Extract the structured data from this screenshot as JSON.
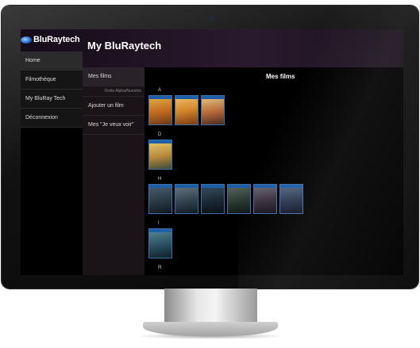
{
  "brand": {
    "logo_text": "BluRaytech",
    "app_title": "My BluRaytech"
  },
  "nav": {
    "items": [
      {
        "label": "Home"
      },
      {
        "label": "Filmothèque"
      },
      {
        "label": "My BluRay Tech"
      },
      {
        "label": "Déconnexion"
      }
    ]
  },
  "submenu": {
    "items": [
      {
        "label": "Mes films"
      },
      {
        "label": "Ajouter un film"
      },
      {
        "label": "Mes \"Je veux voir\""
      }
    ],
    "note": "Ordre Alpha/Numéric"
  },
  "content": {
    "title": "Mes films",
    "groups": [
      {
        "letter": "A",
        "count": 3
      },
      {
        "letter": "D",
        "count": 1
      },
      {
        "letter": "H",
        "count": 6
      },
      {
        "letter": "I",
        "count": 1
      },
      {
        "letter": "R",
        "count": 0
      }
    ]
  },
  "colors": {
    "accent": "#3c6fa8",
    "header": "#2a1a2e",
    "submenu": "#1a1419"
  }
}
